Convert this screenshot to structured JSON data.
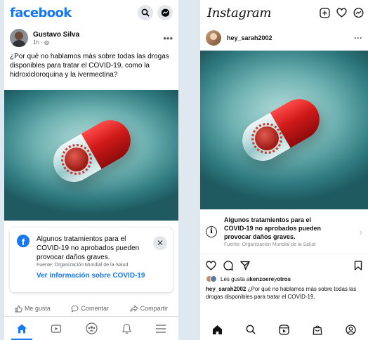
{
  "facebook": {
    "logo": "facebook",
    "post": {
      "author": "Gustavo Silva",
      "meta": "1h · ",
      "text": "¿Por qué no hablamos más sobre todas las drogas disponibles para tratar el COVID-19, como la hidroxicloroquina y la ivermectina?"
    },
    "info_card": {
      "message": "Algunos tratamientos para el COVID-19 no aprobados pueden provocar daños graves.",
      "source": "Fuente: Organización Mundial de la Salud",
      "link": "Ver información sobre COVID-19",
      "close": "✕"
    },
    "actions": {
      "like": "Me gusta",
      "comment": "Comentar",
      "share": "Compartir"
    },
    "nav": [
      "home-icon",
      "watch-icon",
      "groups-icon",
      "notifications-icon",
      "menu-icon"
    ],
    "brand_color": "#1877f2"
  },
  "instagram": {
    "logo": "Instagram",
    "post": {
      "username": "hey_sarah2002",
      "caption_user": "hey_sarah2002",
      "caption_text": " ¿Por qué no hablamos más sobre todas las drogas disponibles para tratar el COVID-19,"
    },
    "info_card": {
      "message": "Algunos tratamientos para el COVID-19 no aprobados pueden provocar daños graves.",
      "source": "Fuente: Organización Mundial de la Salud"
    },
    "likes": {
      "prefix": "Les gusta a ",
      "user": "kenzoere",
      "middle": " y ",
      "others": "otros"
    },
    "nav": [
      "home-icon",
      "search-icon",
      "reels-icon",
      "shop-icon",
      "profile-icon"
    ]
  }
}
